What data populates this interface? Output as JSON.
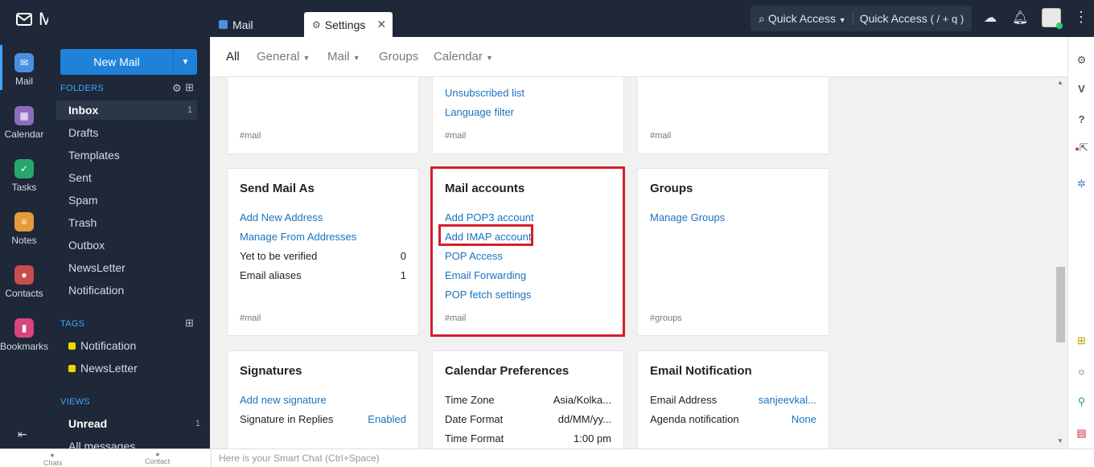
{
  "app": {
    "title": "Mail"
  },
  "rail": {
    "items": [
      {
        "label": "Mail",
        "icon": "mail-icon",
        "color": "#4a90e2"
      },
      {
        "label": "Calendar",
        "icon": "calendar-icon",
        "color": "#8e6bbf"
      },
      {
        "label": "Tasks",
        "icon": "tasks-icon",
        "color": "#27a86b"
      },
      {
        "label": "Notes",
        "icon": "notes-icon",
        "color": "#e59b3c"
      },
      {
        "label": "Contacts",
        "icon": "contacts-icon",
        "color": "#c94c4c"
      },
      {
        "label": "Bookmarks",
        "icon": "bookmarks-icon",
        "color": "#d9457a"
      }
    ]
  },
  "sidebar": {
    "new_mail": "New Mail",
    "folders_head": "FOLDERS",
    "folders": [
      {
        "label": "Inbox",
        "count": "1"
      },
      {
        "label": "Drafts"
      },
      {
        "label": "Templates"
      },
      {
        "label": "Sent"
      },
      {
        "label": "Spam"
      },
      {
        "label": "Trash"
      },
      {
        "label": "Outbox"
      },
      {
        "label": "NewsLetter"
      },
      {
        "label": "Notification"
      }
    ],
    "tags_head": "TAGS",
    "tags": [
      {
        "label": "Notification"
      },
      {
        "label": "NewsLetter"
      }
    ],
    "views_head": "VIEWS",
    "views": [
      {
        "label": "Unread",
        "count": "1"
      },
      {
        "label": "All messages"
      }
    ]
  },
  "topbar": {
    "tabs": [
      {
        "label": "Mail"
      },
      {
        "label": "Settings"
      }
    ],
    "quick_access": "Quick Access",
    "quick_access_hint": "Quick Access",
    "quick_access_shortcut": "( / + q )"
  },
  "subnav": {
    "items": [
      "All",
      "General",
      "Mail",
      "Groups",
      "Calendar"
    ]
  },
  "cards": {
    "top_middle": {
      "links": [
        "Unsubscribed list",
        "Language filter"
      ],
      "hash": "#mail"
    },
    "top_left": {
      "hash": "#mail"
    },
    "top_right": {
      "hash": "#mail"
    },
    "send_mail_as": {
      "title": "Send Mail As",
      "links": [
        "Add New Address",
        "Manage From Addresses"
      ],
      "rows": [
        {
          "label": "Yet to be verified",
          "value": "0"
        },
        {
          "label": "Email aliases",
          "value": "1"
        }
      ],
      "hash": "#mail"
    },
    "mail_accounts": {
      "title": "Mail accounts",
      "links": [
        "Add POP3 account",
        "Add IMAP account",
        "POP Access",
        "Email Forwarding",
        "POP fetch settings"
      ],
      "hash": "#mail"
    },
    "groups": {
      "title": "Groups",
      "links": [
        "Manage Groups"
      ],
      "hash": "#groups"
    },
    "signatures": {
      "title": "Signatures",
      "links": [
        "Add new signature"
      ],
      "rows": [
        {
          "label": "Signature in Replies",
          "value": "Enabled"
        }
      ]
    },
    "calendar_prefs": {
      "title": "Calendar Preferences",
      "rows": [
        {
          "label": "Time Zone",
          "value": "Asia/Kolka..."
        },
        {
          "label": "Date Format",
          "value": "dd/MM/yy..."
        },
        {
          "label": "Time Format",
          "value": "1:00 pm"
        }
      ]
    },
    "email_notification": {
      "title": "Email Notification",
      "rows": [
        {
          "label": "Email Address",
          "value": "sanjeevkal..."
        },
        {
          "label": "Agenda notification",
          "value": "None"
        }
      ]
    }
  },
  "bottombar": {
    "smart_chat": "Here is your Smart Chat (Ctrl+Space)",
    "chats": "Chats",
    "contacts": "Contacts"
  }
}
